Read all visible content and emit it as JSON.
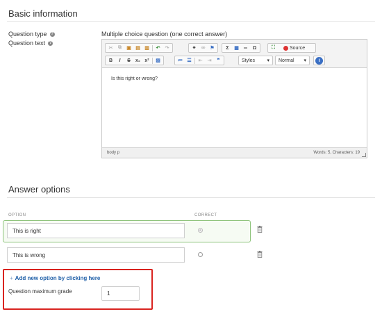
{
  "basic_info": {
    "title": "Basic information",
    "question_type_label": "Question type",
    "question_type_value": "Multiple choice question (one correct answer)",
    "question_text_label": "Question text"
  },
  "editor": {
    "styles_combo": "Styles",
    "format_combo": "Normal",
    "source_label": "Source",
    "content": "Is this right or wrong?",
    "status_path": "body  p",
    "word_count": "Words: 5, Characters: 19"
  },
  "answer_options": {
    "title": "Answer options",
    "col_option": "OPTION",
    "col_correct": "CORRECT",
    "options": [
      {
        "text": "This is right",
        "correct": true
      },
      {
        "text": "This is wrong",
        "correct": false
      }
    ],
    "add_option_label": "Add new option by clicking here",
    "add_option_plus": "+",
    "max_grade_label": "Question maximum grade",
    "max_grade_value": "1"
  },
  "colors": {
    "accent_link": "#1f5fa8",
    "highlight_border": "#d9231f",
    "correct_border": "#8dc37a"
  }
}
